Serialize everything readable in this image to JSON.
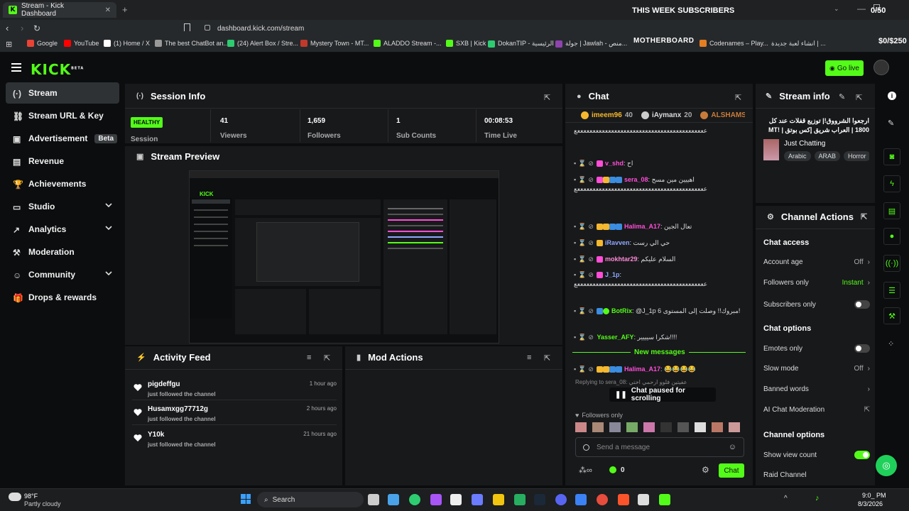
{
  "browser": {
    "tab_title": "Stream - Kick Dashboard",
    "url": "dashboard.kick.com/stream",
    "bookmarks": [
      "Google",
      "YouTube",
      "(1) Home / X",
      "The best ChatBot an...",
      "(24) Alert Box / Stre...",
      "Mystery Town - MT...",
      "ALADDO Stream -...",
      "SXB | Kick",
      "DokanTIP - الرئيسية",
      "جولة | Jawlah - منص...",
      "Codenames – Play...",
      "انشاء لعبة جديدة | ..."
    ]
  },
  "overlay": {
    "title": "THIS WEEK SUBSCRIBERS",
    "count": "0/50",
    "money": "$0/$250",
    "board": "MOTHERBOARD"
  },
  "header": {
    "logo": "KICK",
    "logo_sup": "BETA",
    "go_live": "Go live"
  },
  "sidebar": {
    "items": [
      {
        "label": "Stream"
      },
      {
        "label": "Stream URL & Key"
      },
      {
        "label": "Advertisement",
        "badge": "Beta"
      },
      {
        "label": "Revenue"
      },
      {
        "label": "Achievements"
      },
      {
        "label": "Studio"
      },
      {
        "label": "Analytics"
      },
      {
        "label": "Moderation"
      },
      {
        "label": "Community"
      },
      {
        "label": "Drops & rewards"
      }
    ]
  },
  "session": {
    "title": "Session Info",
    "status": "HEALTHY",
    "status_label": "Session",
    "stats": [
      {
        "value": "41",
        "label": "Viewers"
      },
      {
        "value": "1,659",
        "label": "Followers"
      },
      {
        "value": "1",
        "label": "Sub Counts"
      },
      {
        "value": "00:08:53",
        "label": "Time Live"
      }
    ]
  },
  "preview": {
    "title": "Stream Preview"
  },
  "activity": {
    "title": "Activity Feed",
    "items": [
      {
        "name": "pigdeffgu",
        "action": "just followed the channel",
        "time": "1 hour ago"
      },
      {
        "name": "Husamxgg77712g",
        "action": "just followed the channel",
        "time": "2 hours ago"
      },
      {
        "name": "Y10k",
        "action": "just followed the channel",
        "time": "21 hours ago"
      }
    ]
  },
  "mod_actions": {
    "title": "Mod Actions"
  },
  "chat": {
    "title": "Chat",
    "top_gifters": [
      {
        "name": "imeem96",
        "count": "40"
      },
      {
        "name": "iAymanx",
        "count": "20"
      },
      {
        "name": "ALSHAMSI",
        "count": ""
      }
    ],
    "spam": "ععععععععععععععععععععععععععععععععععععععععععع",
    "messages": [
      {
        "user": "v_shd",
        "color": "#ff4dd8",
        "text": "اح"
      },
      {
        "user": "sera_08",
        "color": "#ff4dd8",
        "text": "اهييين مين مسح"
      },
      {
        "user": "Halima_A17",
        "color": "#ff4dd8",
        "text": "تعال الجين"
      },
      {
        "user": "iRavven",
        "color": "#8fa8ff",
        "text": "حي الي رست"
      },
      {
        "user": "mokhtar29",
        "color": "#ff8ad8",
        "text": "السلام عليكم"
      },
      {
        "user": "J_1p",
        "color": "#8fa8ff",
        "text": ""
      },
      {
        "user": "BotRix",
        "color": "#53fc18",
        "text": "@J_1p مبروك!! وصلت إلى المستوى 6!"
      },
      {
        "user": "Yasser_AFY",
        "color": "#53fc18",
        "text": "شكرا سيييير!!!!"
      },
      {
        "user": "Halima_A17",
        "color": "#ff4dd8",
        "text": "😂😂😂😂"
      }
    ],
    "new_messages": "New messages",
    "replying_to": "Replying to sera_08: عفيتين فلوو ارحمي اختي",
    "paused": "Chat paused for scrolling",
    "followers_only": "Followers only",
    "input_placeholder": "Send a message",
    "points": "0",
    "send_label": "Chat"
  },
  "stream_info": {
    "title": "Stream info",
    "stream_title": "ارجعوا الشرووق!| توزيع قفلات عند كل 1800 | العراب شريق إكس بوتق | !MT",
    "category": "Just Chatting",
    "tags": [
      "Arabic",
      "ARAB",
      "Horror"
    ]
  },
  "channel_actions": {
    "title": "Channel Actions",
    "sections": [
      {
        "heading": "Chat access"
      },
      {
        "heading": "Chat options"
      },
      {
        "heading": "Channel options"
      }
    ],
    "options": [
      {
        "label": "Account age",
        "value": "Off"
      },
      {
        "label": "Followers only",
        "value": "Instant"
      },
      {
        "label": "Subscribers only",
        "value": ""
      },
      {
        "label": "Emotes only",
        "value": ""
      },
      {
        "label": "Slow mode",
        "value": "Off"
      },
      {
        "label": "Banned words",
        "value": ""
      },
      {
        "label": "AI Chat Moderation",
        "value": ""
      },
      {
        "label": "Show view count",
        "value": ""
      },
      {
        "label": "Raid Channel",
        "value": ""
      }
    ]
  },
  "taskbar": {
    "temp": "98°F",
    "weather": "Partly cloudy",
    "search": "Search",
    "time": "9:0_ PM",
    "date": "8/3/2026"
  },
  "colors": {
    "accent": "#53fc18",
    "panel": "#18191b",
    "bg": "#0b0d0e"
  }
}
